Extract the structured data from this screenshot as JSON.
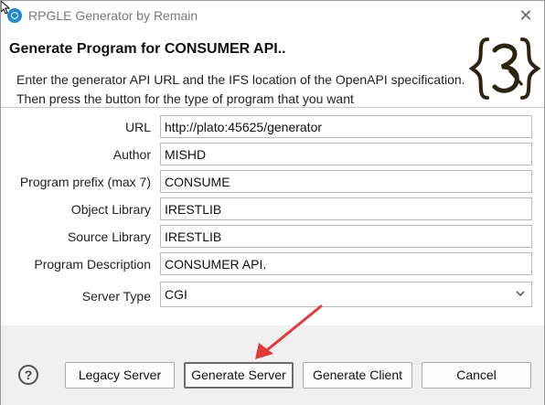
{
  "window": {
    "title": "RPGLE Generator by Remain",
    "close_glyph": "✕"
  },
  "header": {
    "title": "Generate Program for CONSUMER API..",
    "description": "Enter the generator API URL and the IFS location of the OpenAPI specification. Then press the button for the type of program that you want",
    "logo_text": "{3}"
  },
  "form": {
    "fields": [
      {
        "label": "URL",
        "value": "http://plato:45625/generator"
      },
      {
        "label": "Author",
        "value": "MISHD"
      },
      {
        "label": "Program prefix (max 7)",
        "value": "CONSUME"
      },
      {
        "label": "Object Library",
        "value": "IRESTLIB"
      },
      {
        "label": "Source Library",
        "value": "IRESTLIB"
      },
      {
        "label": "Program Description",
        "value": "CONSUMER API."
      }
    ],
    "server_type": {
      "label": "Server Type",
      "value": "CGI"
    }
  },
  "footer": {
    "help_glyph": "?",
    "buttons": {
      "legacy_server": "Legacy Server",
      "generate_server": "Generate Server",
      "generate_client": "Generate Client",
      "cancel": "Cancel"
    }
  },
  "colors": {
    "annotation_arrow": "#e03a3a",
    "app_icon": "#1e88d2"
  }
}
